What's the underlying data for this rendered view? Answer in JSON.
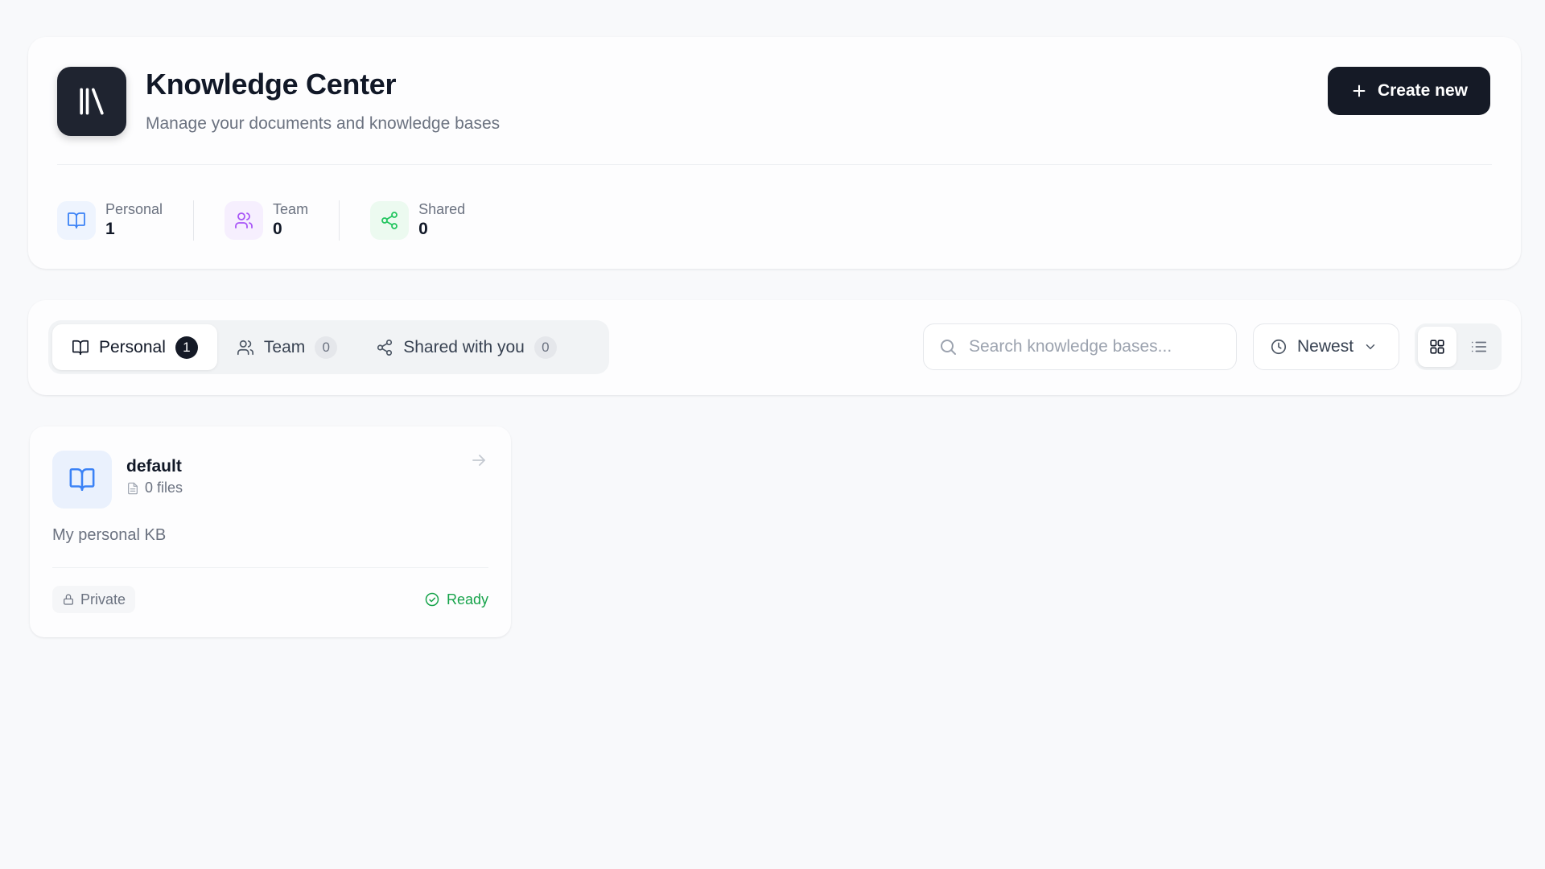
{
  "header": {
    "title": "Knowledge Center",
    "subtitle": "Manage your documents and knowledge bases",
    "create_label": "Create new",
    "logo_icon": "library-icon"
  },
  "stats": [
    {
      "label": "Personal",
      "value": "1",
      "icon": "book-icon",
      "color": "#3b82f6"
    },
    {
      "label": "Team",
      "value": "0",
      "icon": "users-icon",
      "color": "#a855f7"
    },
    {
      "label": "Shared",
      "value": "0",
      "icon": "share-icon",
      "color": "#22c55e"
    }
  ],
  "tabs": [
    {
      "label": "Personal",
      "count": "1",
      "icon": "book-icon",
      "active": true
    },
    {
      "label": "Team",
      "count": "0",
      "icon": "users-icon",
      "active": false
    },
    {
      "label": "Shared with you",
      "count": "0",
      "icon": "share-icon",
      "active": false
    }
  ],
  "search": {
    "placeholder": "Search knowledge bases..."
  },
  "sort": {
    "selected": "Newest"
  },
  "view": {
    "active": "grid"
  },
  "knowledge_bases": [
    {
      "name": "default",
      "files": "0 files",
      "description": "My personal KB",
      "privacy": "Private",
      "status": "Ready"
    }
  ],
  "colors": {
    "primary_dark": "#151a26",
    "accent_blue": "#3b82f6",
    "accent_purple": "#a855f7",
    "accent_green": "#22c55e",
    "status_ready": "#16a34a"
  }
}
